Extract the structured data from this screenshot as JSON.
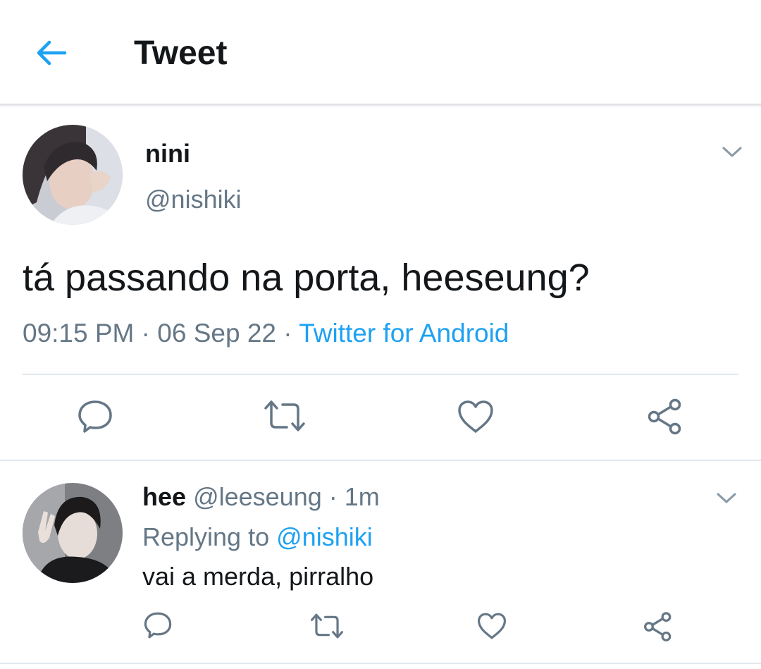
{
  "header": {
    "title": "Tweet",
    "back_icon": "back-arrow-icon",
    "accent_color": "#1da1f2"
  },
  "tweet": {
    "display_name": "nini",
    "handle": "@nishiki",
    "text": "tá passando na porta, heeseung?",
    "time": "09:15 PM",
    "date": "06 Sep 22",
    "source": "Twitter for Android",
    "separator": " · ",
    "actions": [
      "reply-icon",
      "retweet-icon",
      "like-icon",
      "share-icon"
    ]
  },
  "reply": {
    "display_name": "hee",
    "handle": "@leeseung",
    "time_ago": "1m",
    "replying_label": "Replying to",
    "replying_to": "@nishiki",
    "text": "vai a merda, pirralho",
    "actions": [
      "reply-icon",
      "retweet-icon",
      "like-icon",
      "share-icon"
    ]
  },
  "colors": {
    "text": "#14171a",
    "secondary": "#657786",
    "link": "#1da1f2",
    "divider": "#e1e8ed"
  }
}
